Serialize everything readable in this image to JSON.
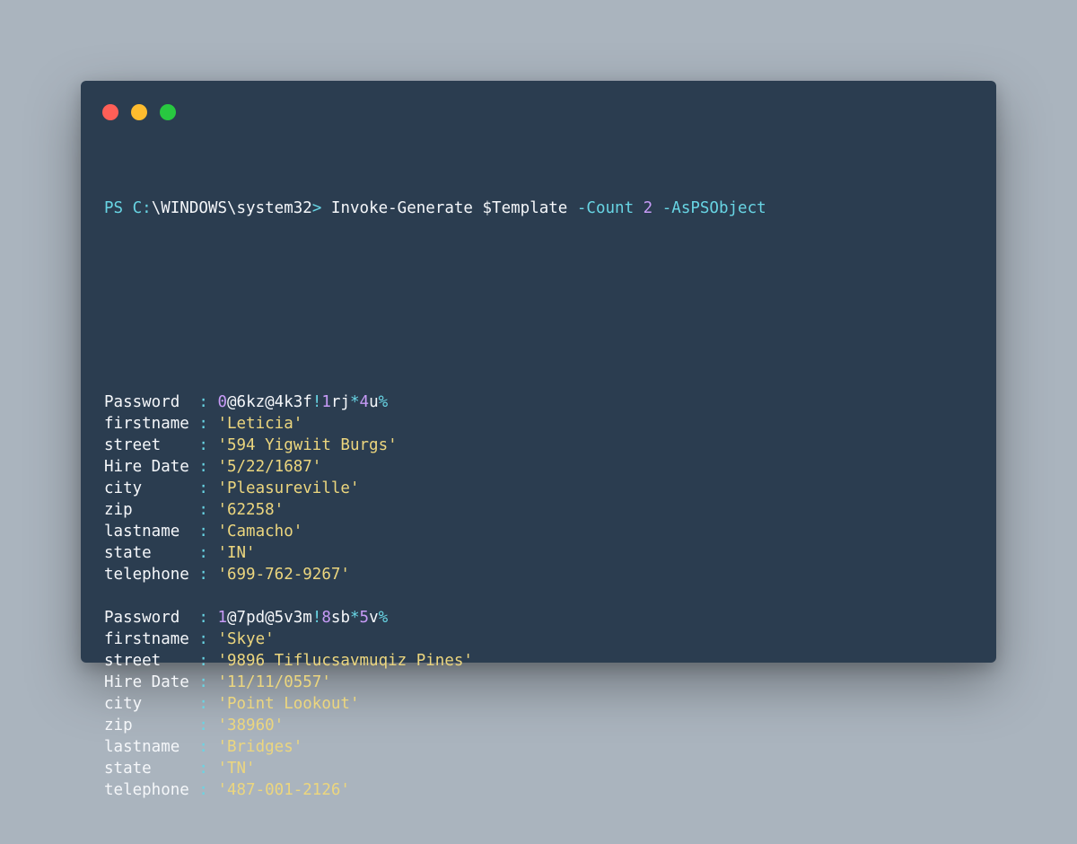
{
  "window": {
    "controls": [
      {
        "name": "close",
        "color": "#ff5f57"
      },
      {
        "name": "minimize",
        "color": "#febc2e"
      },
      {
        "name": "maximize",
        "color": "#28c840"
      }
    ]
  },
  "colors": {
    "background": "#aab4be",
    "terminal_bg": "#2b3d50",
    "prompt": "#68d5e4",
    "number": "#c79bf6",
    "string": "#ecd67e",
    "text": "#f5f7fa"
  },
  "prompt": {
    "ps": "PS",
    "drive": "C:",
    "path": "\\WINDOWS\\system32",
    "arrow": ">",
    "command": "Invoke-Generate",
    "variable": "$Template",
    "param1": "-Count",
    "count": "2",
    "param2": "-AsPSObject"
  },
  "records": [
    {
      "password_tokens": [
        {
          "t": "0",
          "c": "num"
        },
        {
          "t": "@6kz@4k3f",
          "c": "key"
        },
        {
          "t": "!",
          "c": "sep"
        },
        {
          "t": "1",
          "c": "num"
        },
        {
          "t": "rj",
          "c": "key"
        },
        {
          "t": "*",
          "c": "sep"
        },
        {
          "t": "4",
          "c": "num"
        },
        {
          "t": "u",
          "c": "key"
        },
        {
          "t": "%",
          "c": "sep"
        }
      ],
      "fields": [
        {
          "label": "Password  ",
          "sep": ":"
        },
        {
          "label": "firstname ",
          "sep": ":",
          "value": "'Leticia'"
        },
        {
          "label": "street    ",
          "sep": ":",
          "value": "'594 Yigwiit Burgs'"
        },
        {
          "label": "Hire Date ",
          "sep": ":",
          "value": "'5/22/1687'"
        },
        {
          "label": "city      ",
          "sep": ":",
          "value": "'Pleasureville'"
        },
        {
          "label": "zip       ",
          "sep": ":",
          "value": "'62258'"
        },
        {
          "label": "lastname  ",
          "sep": ":",
          "value": "'Camacho'"
        },
        {
          "label": "state     ",
          "sep": ":",
          "value": "'IN'"
        },
        {
          "label": "telephone ",
          "sep": ":",
          "value": "'699-762-9267'"
        }
      ]
    },
    {
      "password_tokens": [
        {
          "t": "1",
          "c": "num"
        },
        {
          "t": "@7pd@5v3m",
          "c": "key"
        },
        {
          "t": "!",
          "c": "sep"
        },
        {
          "t": "8",
          "c": "num"
        },
        {
          "t": "sb",
          "c": "key"
        },
        {
          "t": "*",
          "c": "sep"
        },
        {
          "t": "5",
          "c": "num"
        },
        {
          "t": "v",
          "c": "key"
        },
        {
          "t": "%",
          "c": "sep"
        }
      ],
      "fields": [
        {
          "label": "Password  ",
          "sep": ":"
        },
        {
          "label": "firstname ",
          "sep": ":",
          "value": "'Skye'"
        },
        {
          "label": "street    ",
          "sep": ":",
          "value": "'9896 Tiflucsavmuqiz Pines'"
        },
        {
          "label": "Hire Date ",
          "sep": ":",
          "value": "'11/11/0557'"
        },
        {
          "label": "city      ",
          "sep": ":",
          "value": "'Point Lookout'"
        },
        {
          "label": "zip       ",
          "sep": ":",
          "value": "'38960'"
        },
        {
          "label": "lastname  ",
          "sep": ":",
          "value": "'Bridges'"
        },
        {
          "label": "state     ",
          "sep": ":",
          "value": "'TN'"
        },
        {
          "label": "telephone ",
          "sep": ":",
          "value": "'487-001-2126'"
        }
      ]
    }
  ]
}
